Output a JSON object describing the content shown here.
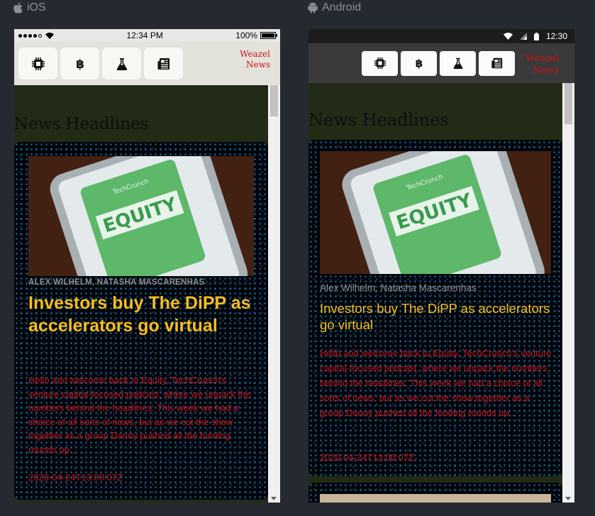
{
  "labels": {
    "ios": "iOS",
    "android": "Android"
  },
  "ios": {
    "status": {
      "time": "12:34 PM",
      "battery": "100%"
    },
    "toolbar": {
      "buttons": [
        {
          "icon": "chip-icon"
        },
        {
          "icon": "bitcoin-icon"
        },
        {
          "icon": "flask-icon"
        },
        {
          "icon": "newspaper-icon"
        }
      ],
      "brand_line1": "Weazel",
      "brand_line2": "News"
    },
    "section_title": "News Headlines",
    "article": {
      "image_text": "EQUITY",
      "image_brand": "TechCrunch",
      "authors": "ALEX WILHELM, NATASHA MASCARENHAS",
      "title": "Investors buy The DiPP as accelerators go virtual",
      "summary": "Hello and welcome back to Equity, TechCrunch's venture capital-focused podcast, where we unpack the numbers behind the headlines. This week we had a choice of all sorts of news, but as we cut the show together as a group Danny pushed all the funding rounds up...",
      "date": "2020-04-24T13:00:07Z"
    }
  },
  "android": {
    "status": {
      "time": "12:30"
    },
    "toolbar": {
      "buttons": [
        {
          "icon": "chip-icon"
        },
        {
          "icon": "bitcoin-icon"
        },
        {
          "icon": "flask-icon"
        },
        {
          "icon": "newspaper-icon"
        }
      ],
      "brand_line1": "Weazel",
      "brand_line2": "News"
    },
    "section_title": "News Headlines",
    "article": {
      "image_text": "EQUITY",
      "image_brand": "TechCrunch",
      "authors": "Alex Wilhelm, Natasha Mascarenhas",
      "title": "Investors buy The DiPP as accelerators go virtual",
      "summary": "Hello and welcome back to Equity, TechCrunch's venture capital-focused podcast, where we unpack the numbers behind the headlines. This week we had a choice of all sorts of news, but as we cut the show together as a group Danny pushed all the funding rounds up...",
      "date": "2020-04-24T13:00:07Z"
    }
  },
  "colors": {
    "background": "#252a30",
    "title_yellow": "#f5bd1e",
    "summary_red": "#c8121b",
    "brand_red": "#d0101a",
    "content_bg": "#222b16"
  }
}
